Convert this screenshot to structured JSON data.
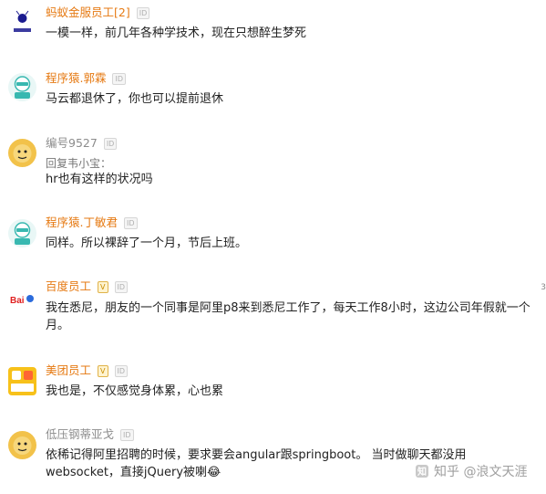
{
  "comments": [
    {
      "author": "蚂蚁金服员工[2]",
      "id_badge": "ID",
      "text": "一模一样，前几年各种学技术，现在只想醉生梦死",
      "avatar": {
        "label": "蚂蚁金服",
        "icon": "ant-logo-icon",
        "color": "#1a1a8f"
      }
    },
    {
      "author": "程序猿.郭霖",
      "id_badge": "ID",
      "text": "马云都退休了，你也可以提前退休",
      "avatar": {
        "icon": "programmer-robot-icon",
        "color": "#38b8b0"
      }
    },
    {
      "author": "编号9527",
      "id_badge": "ID",
      "reply_to": "回复韦小宝：",
      "text": "hr也有这样的状况吗",
      "avatar": {
        "icon": "monkey-face-icon",
        "color": "#f2c24a"
      }
    },
    {
      "author": "程序猿.丁敏君",
      "id_badge": "ID",
      "text": "同样。所以裸辞了一个月，节后上班。",
      "avatar": {
        "icon": "programmer-robot-icon",
        "color": "#38b8b0"
      }
    },
    {
      "author": "百度员工",
      "v_badge": "V",
      "id_badge": "ID",
      "text": "我在悉尼，朋友的一个同事是阿里p8来到悉尼工作了，每天工作8小时，这边公司年假就一个月。",
      "avatar": {
        "label": "Bai",
        "icon": "baidu-logo-icon",
        "color": "#e02020"
      }
    },
    {
      "author": "美团员工",
      "v_badge": "V",
      "id_badge": "ID",
      "text": "我也是，不仅感觉身体累，心也累",
      "avatar": {
        "label": "美团点评",
        "icon": "meituan-logo-icon",
        "color": "#f7c11a"
      }
    },
    {
      "author": "低压钢蒂亚戈",
      "id_badge": "ID",
      "text": "依稀记得阿里招聘的时候，要求要会angular跟springboot。 当时做聊天都没用websocket，直接jQuery被喇😂",
      "avatar": {
        "icon": "monkey-face-icon",
        "color": "#f2c24a"
      }
    }
  ],
  "watermark": {
    "text": "知乎 @浪文天涯",
    "icon": "zhihu-logo-icon"
  },
  "right_marks": [
    "3",
    "3"
  ]
}
